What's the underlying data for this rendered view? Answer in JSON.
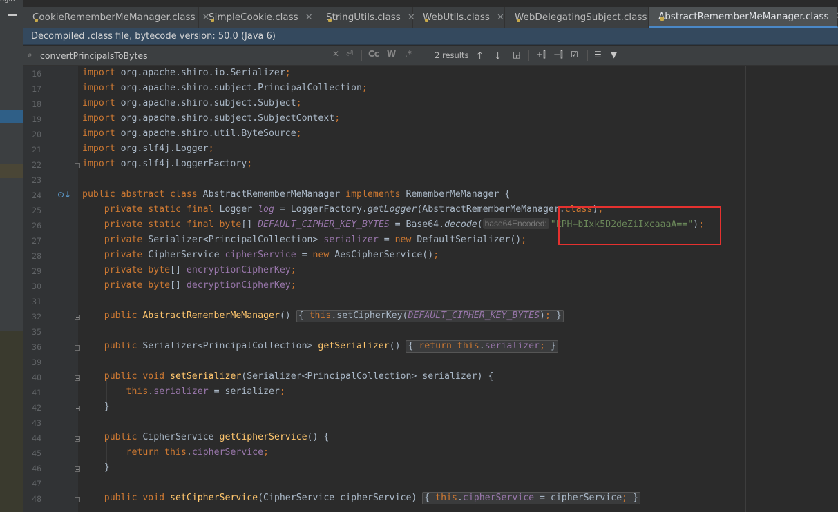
{
  "tabs": [
    {
      "label": "CookieRememberMeManager.class",
      "active": false
    },
    {
      "label": "SimpleCookie.class",
      "active": false
    },
    {
      "label": "StringUtils.class",
      "active": false
    },
    {
      "label": "WebUtils.class",
      "active": false
    },
    {
      "label": "WebDelegatingSubject.class",
      "active": false
    },
    {
      "label": "AbstractRememberMeManager.class",
      "active": true
    }
  ],
  "notice": "Decompiled .class file, bytecode version: 50.0 (Java 6)",
  "search": {
    "query": "convertPrincipalsToBytes",
    "results": "2 results",
    "match_case": "Cc",
    "words": "W",
    "regex": ".*"
  },
  "top_fragment": "ogin",
  "line_numbers": [
    "16",
    "17",
    "18",
    "19",
    "20",
    "21",
    "22",
    "23",
    "24",
    "25",
    "26",
    "27",
    "28",
    "29",
    "30",
    "31",
    "32",
    "35",
    "36",
    "39",
    "40",
    "41",
    "42",
    "43",
    "44",
    "45",
    "46",
    "47",
    "48"
  ],
  "code": {
    "imports": [
      "org.apache.shiro.io.Serializer",
      "org.apache.shiro.subject.PrincipalCollection",
      "org.apache.shiro.subject.Subject",
      "org.apache.shiro.subject.SubjectContext",
      "org.apache.shiro.util.ByteSource",
      "org.slf4j.Logger",
      "org.slf4j.LoggerFactory"
    ],
    "class_name": "AbstractRememberMeManager",
    "interface_name": "RememberMeManager",
    "param_hint": "base64Encoded:",
    "key_literal": "\"kPH+bIxk5D2deZiIxcaaaA==\"",
    "ctor_name": "AbstractRememberMeManager",
    "m_getSerializer": "getSerializer",
    "m_setSerializer": "setSerializer",
    "m_getCipherService": "getCipherService",
    "m_setCipherService": "setCipherService"
  },
  "colors": {
    "keyword": "#cc7832",
    "field": "#9876aa",
    "method": "#ffc66d",
    "string": "#6a8759",
    "highlight_box": "#e5312f"
  }
}
